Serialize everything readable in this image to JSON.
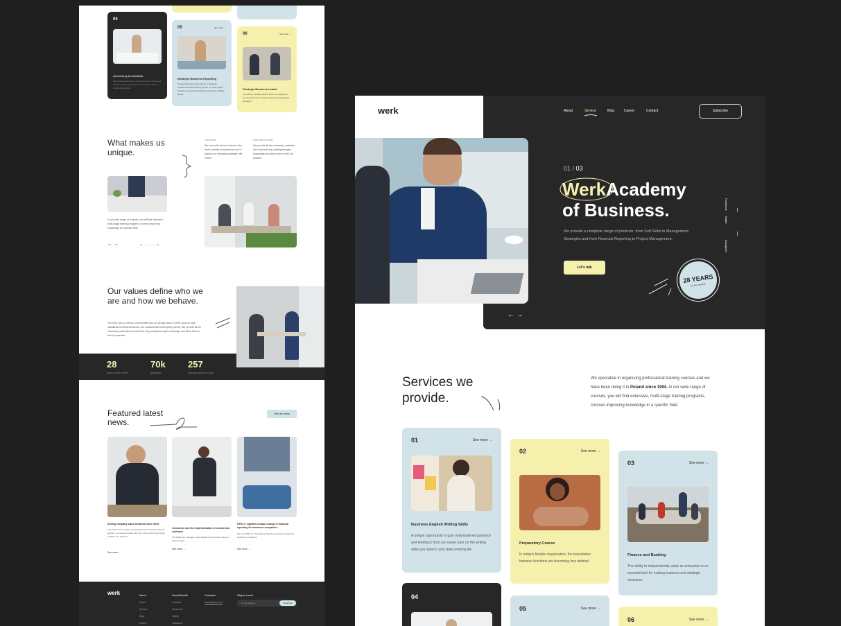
{
  "left": {
    "cards_top": [
      {
        "num": "04",
        "title": "Accounting and Analysis",
        "desc": "We've designed a set of courses covering key areas of accounting to give those working in the field a practical foundation."
      },
      {
        "num": "05",
        "see": "See more →",
        "title": "Strategic Business Reporting",
        "desc": "Strategic Business Reporting is a Strategic Professional level training course. It covers topics related to reports and financial reporting in building books."
      },
      {
        "num": "06",
        "see": "See more →",
        "title": "Strategic Business Leader",
        "desc": "The ability to independently value an enterprise is an essential tool for making business and strategic decisions."
      }
    ],
    "unique": {
      "title": "What makes us unique.",
      "col1_label": "OUR WORK",
      "col1_text": "We work with the best trainers who have a wealth of experience and a passion for sharing knowledge with others.",
      "col2_label": "WHAT WE PROVIDE",
      "col2_text": "We provide all the necessary materials and tools that help participants gain knowledge and allow them to test it in practice.",
      "caption": "In our wide range of courses, you will find extensive, multi-stage training programs, courses improving knowledge in a specific field.",
      "pager": "01 ——— ——— 03"
    },
    "values": {
      "title": "Our values define who we are and how we behave.",
      "text": "The trust that our clients, communities and our people place in Werk, and our high standards of ethical behaviour, are fundamental to everything we do. We provide all the necessary materials and tools that help participants gain knowledge and allow them to test it in practice."
    },
    "stats": [
      {
        "value": "28",
        "label": "years on the market"
      },
      {
        "value": "70k",
        "label": "graduates"
      },
      {
        "value": "257",
        "label": "training courses on offer"
      }
    ],
    "news": {
      "title": "Featured latest news.",
      "see_all": "See all news",
      "items": [
        {
          "title": "Driving company value demands more effort",
          "desc": "The world of the positive consequences for the stock world, for activism, we intend to better their own brand, which will remain valuable and relevant.",
          "more": "See more →"
        },
        {
          "title": "Commerce and the implementation of commercial contracts",
          "desc": "The liability for damages under English law is mostly based on fault principle.",
          "more": "See more →"
        },
        {
          "title": "IFRS 17 signifies a major change in financial reporting for insurance companies.",
          "desc": "The new IFRS 17 International financial reporting standard for insurance companies.",
          "more": "See more →"
        }
      ]
    },
    "footer": {
      "logo": "werk",
      "menu_h": "Menu",
      "menu": [
        "About",
        "Service",
        "Blog",
        "Career"
      ],
      "social_h": "Social Media",
      "social": [
        "LinkedIn",
        "Facebook",
        "Twitter",
        "Instagram"
      ],
      "contacts_h": "Contacts",
      "contacts": [
        "hello@werk.com"
      ],
      "touch_h": "Stay in touch",
      "email_placeholder": "E-mail address",
      "subscribe": "Subscribe"
    }
  },
  "right": {
    "logo": "werk",
    "nav": [
      "About",
      "Service",
      "Blog",
      "Career",
      "Contact"
    ],
    "subscribe": "Subscribe",
    "slide_counter": "01 / ",
    "slide_total": "03",
    "hero_word1": "Werk",
    "hero_word2": "Academy",
    "hero_line2": "of Business.",
    "hero_text": "We provide a complete range of products, from Soft Skills to Management Strategies and from Financial Reporting to Project Management.",
    "cta": "Let's talk",
    "badge_main": "28 YEARS",
    "badge_sub": "on the market",
    "social": [
      "Facebook",
      "Twitter",
      "Instagram"
    ],
    "services_title": "Services we provide.",
    "services_text_a": "We specialise in organising professional training courses and we have been doing it in ",
    "services_text_bold": "Poland since 1994.",
    "services_text_b": " In our wide range of courses, you will find extensive, multi-stage training programs, courses improving knowledge in a specific field.",
    "cards": [
      {
        "num": "01",
        "see": "See more →",
        "title": "Business English Writing Skills",
        "desc": "A unique opportunity to gain individualised guidance and feedback from our expert tutor on the writing skills you need in your daily working life."
      },
      {
        "num": "02",
        "see": "See more →",
        "title": "Preparatory Course",
        "desc": "In today's flexible organization, the boundaries between functions are becoming less defined."
      },
      {
        "num": "03",
        "see": "See more →",
        "title": "Finance and Banking",
        "desc": "The ability to independently value an enterprise is an essential tool for making business and strategic decisions."
      },
      {
        "num": "04",
        "see": "",
        "title": "",
        "desc": ""
      },
      {
        "num": "05",
        "see": "See more →",
        "title": "",
        "desc": ""
      },
      {
        "num": "06",
        "see": "See more →",
        "title": "",
        "desc": ""
      }
    ],
    "arrows": "← →"
  }
}
